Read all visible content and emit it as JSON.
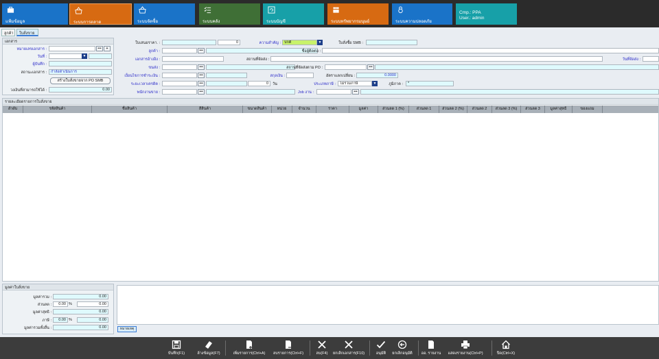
{
  "modules": [
    {
      "label": "แฟ้มข้อมูล",
      "icon": "briefcase-icon",
      "color": "#1a73c8"
    },
    {
      "label": "ระบบการตลาด",
      "icon": "basket-icon",
      "color": "#d76a12",
      "active": true
    },
    {
      "label": "ระบบจัดซื้อ",
      "icon": "basket-icon",
      "color": "#1a73c8"
    },
    {
      "label": "ระบบคลัง",
      "icon": "checklist-icon",
      "color": "#3f6f36"
    },
    {
      "label": "ระบบบัญชี",
      "icon": "refresh-icon",
      "color": "#17a0a8"
    },
    {
      "label": "ระบบทรัพยากรมนุษย์",
      "icon": "people-icon",
      "color": "#d76a12"
    },
    {
      "label": "ระบบความปลอดภัย",
      "icon": "lock-icon",
      "color": "#1a73c8"
    }
  ],
  "company": {
    "cmp": "Cmp.: PPA",
    "user": "User.: admin"
  },
  "tabs": [
    "ลูกค้า",
    "ใบสั่งขาย"
  ],
  "doc_panel": {
    "title": "เอกสาร",
    "doc_no_label": "หมายเลขเอกสาร :",
    "date_label": "วันที่ :",
    "recorder_label": "ผู้บันทึก :",
    "status_label": "สถานะเอกสาร :",
    "status_value": "กำลังดำเนินการ",
    "create_po_button": "สร้างใบสั่งขายจาก PO SMB",
    "credit_label": "วงเงินที่สามารถใช้ได้ :",
    "credit_value": "0.00"
  },
  "form": {
    "quote_no_label": "ใบเสนอราคา. :",
    "quote_no_value": "0",
    "priority_label": "ความสำคัญ :",
    "priority_value": "ปกติ",
    "smb_order_label": "ใบสั่งซื้อ SMB :",
    "customer_label": "ลูกค้า :",
    "contact_label": "ชื่อผู้ติดต่อ :",
    "ref_doc_label": "เอกสารอ้างอิง :",
    "ship_place_label": "สถานที่จัดส่ง :",
    "ship_date_label": "วันที่จัดส่ง :",
    "transport_label": "ขนส่ง :",
    "po_ship_place_label": "สถานที่จัดส่งตาม PO :",
    "payment_label": "เงื่อนไขการชำระเงิน :",
    "currency_label": "สกุลเงิน :",
    "rate_label": "อัตราแลกเปลี่ยน :",
    "rate_value": "0.0000",
    "credit_term_label": "ระยะเวลาเครดิต :",
    "credit_term_value": "0",
    "days_label": "วัน",
    "tax_type_label": "ประเภทภาษี :",
    "tax_type_value": "ไม่รวมภาษี",
    "region_label": "ภูมิภาค :",
    "region_value": "*",
    "sales_label": "พนักงานขาย :",
    "job_label": "Job งาน :"
  },
  "detail": {
    "title": "รายละเอียดรายการใบสั่งขาย",
    "columns": [
      "ลำดับ",
      "รหัสสินค้า",
      "ชื่อสินค้า",
      "สีสินค้า",
      "ขนาดสินค้า",
      "หน่วย",
      "จำนวน",
      "ราคา",
      "มูลค่า",
      "ส่วนลด 1 (%)",
      "ส่วนลด 1",
      "ส่วนลด 2 (%)",
      "ส่วนลด 2",
      "ส่วนลด 3 (%)",
      "ส่วนลด 3",
      "มูลค่าสุทธิ",
      "ของแถม"
    ]
  },
  "summary": {
    "title": "มูลค่าใบสั่งขาย",
    "total_label": "มูลค่ารวม :",
    "total_value": "0.00",
    "discount_label": "ส่วนลด :",
    "discount_pct": "0.00",
    "discount_value": "0.00",
    "net_label": "มูลค่าสุทธิ :",
    "net_value": "0.00",
    "vat_label": "ภาษี :",
    "vat_pct": "0.00",
    "vat_value": "0.00",
    "grand_label": "มูลค่ารวมทั้งสิ้น :",
    "grand_value": "0.00",
    "percent_sign": "%",
    "notes_button": "หมายเหตุ"
  },
  "toolbar": [
    {
      "label": "บันทึก(F1)",
      "icon": "save-icon"
    },
    {
      "label": "ล้างข้อมูล(F7)",
      "icon": "eraser-icon"
    },
    {
      "label": "เพิ่มรายการ(Ctrl+A)",
      "icon": "add-doc-icon"
    },
    {
      "label": "ลบรายการ(Ctrl+F)",
      "icon": "remove-doc-icon"
    },
    {
      "label": "ลบ(F4)",
      "icon": "close-icon"
    },
    {
      "label": "ยกเลิกเอกสาร(F10)",
      "icon": "cancel-doc-icon"
    },
    {
      "label": "อนุมัติ",
      "icon": "check-icon"
    },
    {
      "label": "ยกเลิกอนุมัติ",
      "icon": "undo-icon"
    },
    {
      "label": "ออ. รายงาน",
      "icon": "report-icon"
    },
    {
      "label": "แสดงรายงาน(Ctrl+P)",
      "icon": "print-icon"
    },
    {
      "label": "ปิด(Ctrl+X)",
      "icon": "home-icon"
    }
  ]
}
